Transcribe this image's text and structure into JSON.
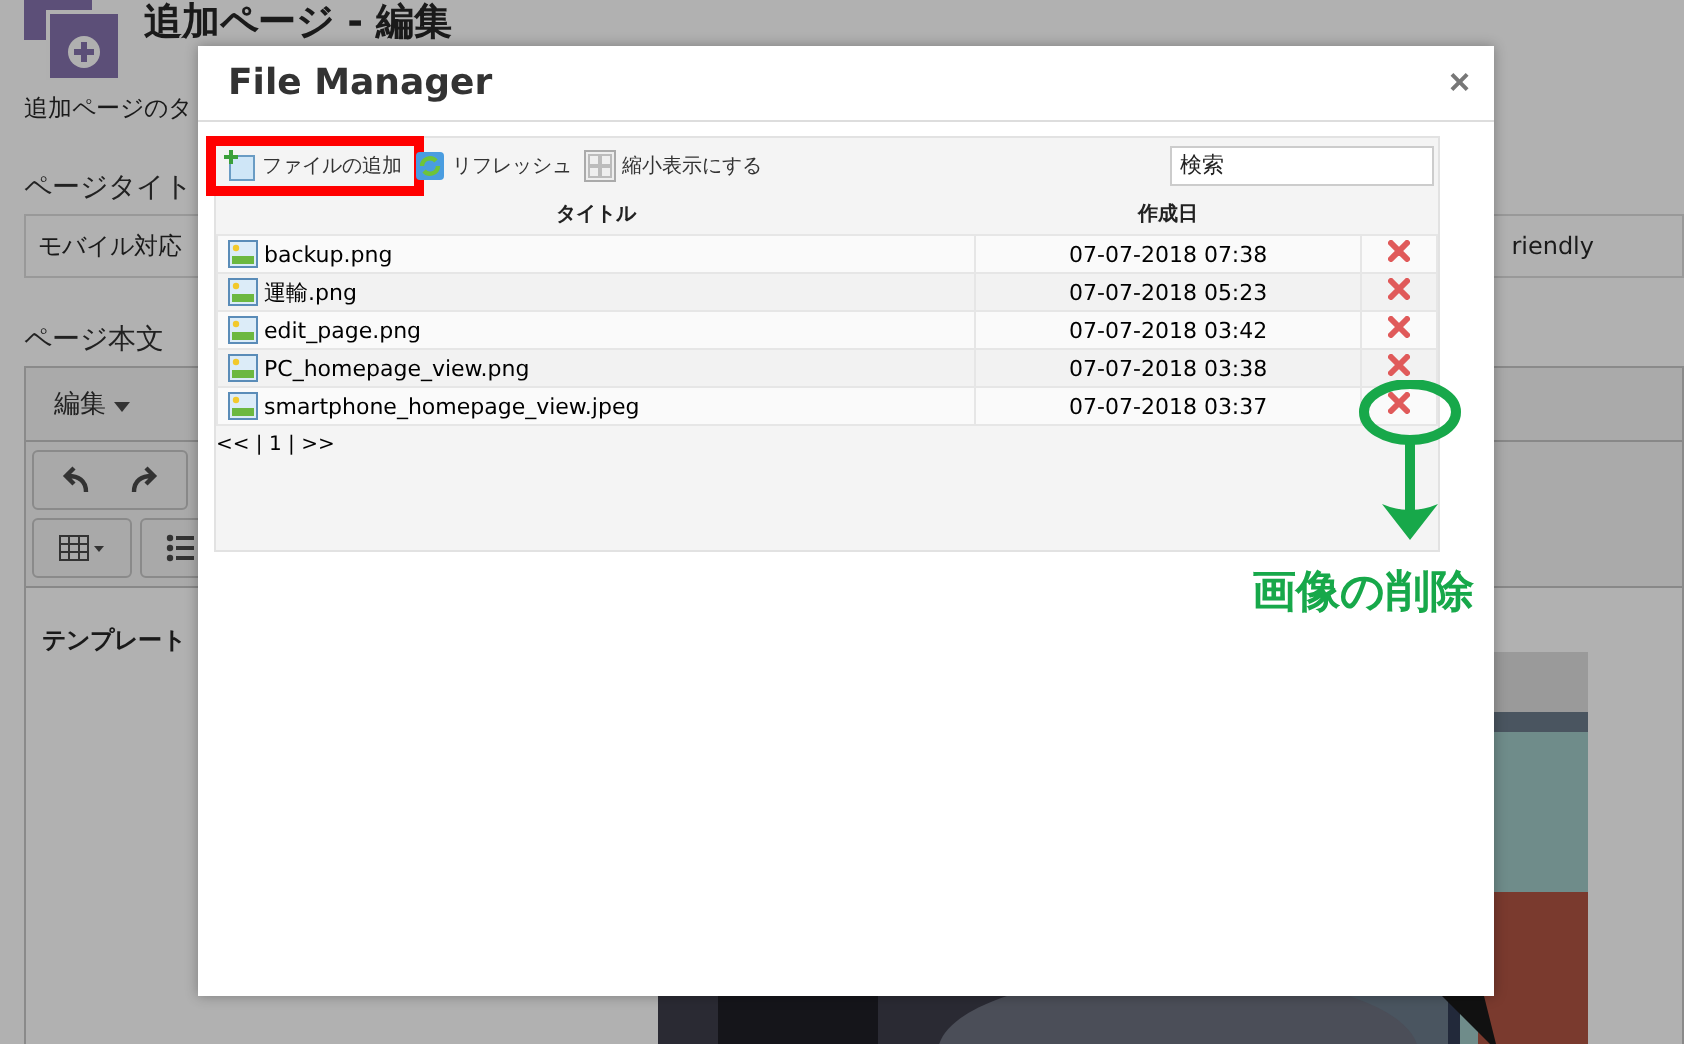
{
  "page": {
    "title": "追加ページ - 編集",
    "subtitle": "追加ページのタ",
    "title_label": "ページタイト",
    "title_field": {
      "value": "モバイル対応"
    },
    "field_right_text": "riendly",
    "body_label": "ページ本文",
    "editor_menu": [
      {
        "label": "編集"
      }
    ],
    "template_label": "テンプレート"
  },
  "dialog": {
    "title": "File Manager",
    "close": "×",
    "toolbar": [
      {
        "label": "ファイルの追加",
        "kind": "add",
        "highlighted": true
      },
      {
        "label": "リフレッシュ",
        "kind": "refresh",
        "highlighted": false
      },
      {
        "label": "縮小表示にする",
        "kind": "thumbnails",
        "highlighted": false
      }
    ],
    "search": {
      "placeholder": "検索"
    },
    "columns": [
      "タイトル",
      "作成日"
    ],
    "rows": [
      {
        "name": "backup.png",
        "date": "07-07-2018 07:38"
      },
      {
        "name": "運輸.png",
        "date": "07-07-2018 05:23"
      },
      {
        "name": "edit_page.png",
        "date": "07-07-2018 03:42"
      },
      {
        "name": "PC_homepage_view.png",
        "date": "07-07-2018 03:38"
      },
      {
        "name": "smartphone_homepage_view.jpeg",
        "date": "07-07-2018 03:37"
      }
    ],
    "pagination": "<< | 1 | >>"
  },
  "annotations": [
    {
      "kind": "callout",
      "label": "画像の削除"
    }
  ]
}
